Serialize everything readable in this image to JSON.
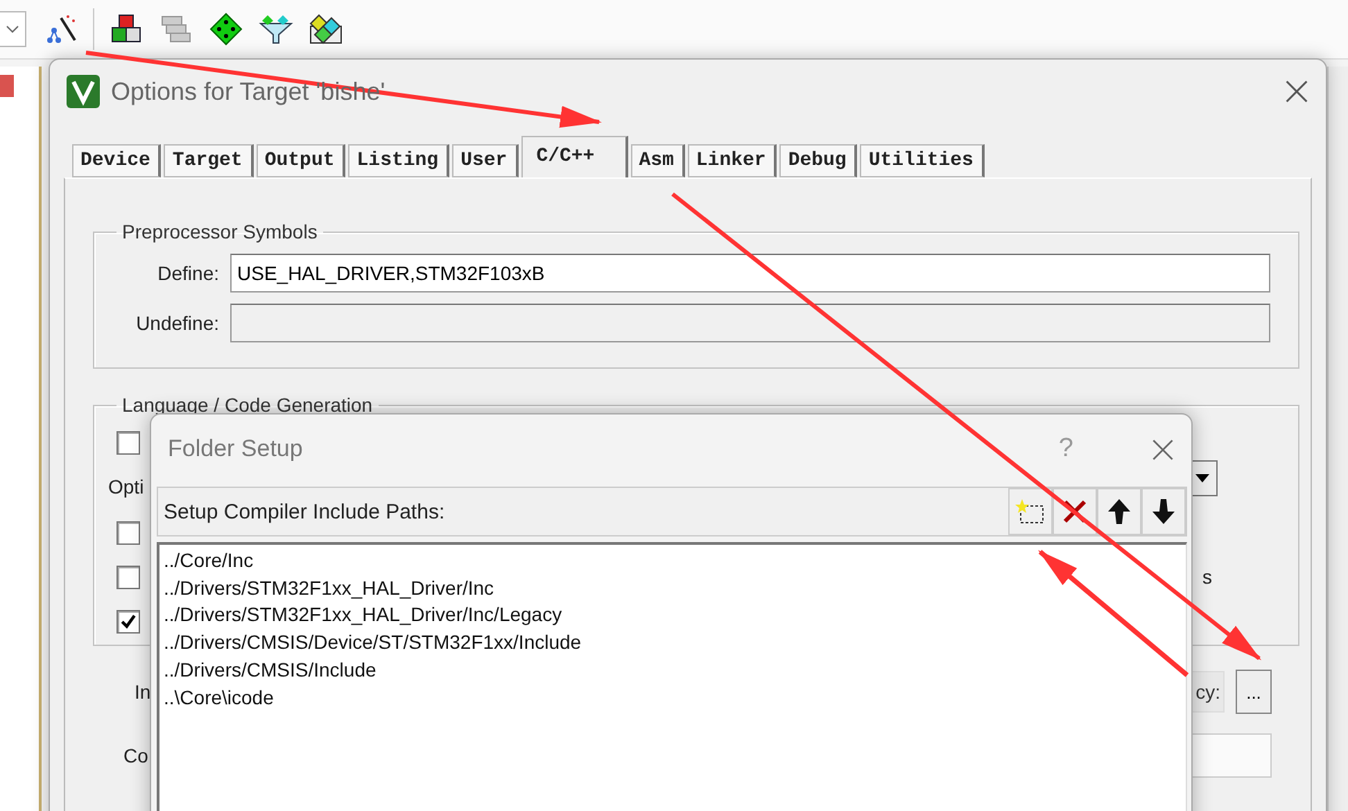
{
  "options_dialog": {
    "title": "Options for Target 'bishe'",
    "tabs": [
      {
        "label": "Device",
        "selected": false
      },
      {
        "label": "Target",
        "selected": false
      },
      {
        "label": "Output",
        "selected": false
      },
      {
        "label": "Listing",
        "selected": false
      },
      {
        "label": "User",
        "selected": false
      },
      {
        "label": "C/C++",
        "selected": true
      },
      {
        "label": "Asm",
        "selected": false
      },
      {
        "label": "Linker",
        "selected": false
      },
      {
        "label": "Debug",
        "selected": false
      },
      {
        "label": "Utilities",
        "selected": false
      }
    ],
    "preprocessor": {
      "title": "Preprocessor Symbols",
      "define_label": "Define:",
      "define_value": "USE_HAL_DRIVER,STM32F103xB",
      "undefine_label": "Undefine:",
      "undefine_disabled": true
    },
    "language": {
      "title": "Language / Code Generation",
      "partial_label": "Opti",
      "right_partial_text": "s",
      "checkboxes": [
        {
          "checked": false
        },
        {
          "checked": false
        },
        {
          "checked": false
        },
        {
          "checked": true
        }
      ]
    },
    "partial_labels": [
      "In",
      "Co"
    ],
    "partial_field_text": "cy:",
    "browse_button": "..."
  },
  "folder_setup": {
    "title": "Folder Setup",
    "help": "?",
    "header": "Setup Compiler Include Paths:",
    "paths": [
      "../Core/Inc",
      "../Drivers/STM32F1xx_HAL_Driver/Inc",
      "../Drivers/STM32F1xx_HAL_Driver/Inc/Legacy",
      "../Drivers/CMSIS/Device/ST/STM32F1xx/Include",
      "../Drivers/CMSIS/Include",
      "..\\Core\\icode"
    ]
  }
}
